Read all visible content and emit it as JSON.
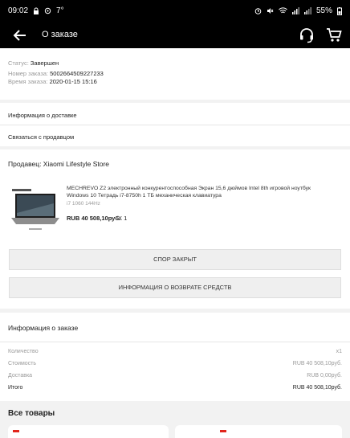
{
  "status_bar": {
    "time": "09:02",
    "temperature": "7°",
    "battery": "55%"
  },
  "app_bar": {
    "title": "О заказе"
  },
  "order": {
    "status_label": "Статус:",
    "status_value": "Завершен",
    "number_label": "Номер заказа:",
    "number_value": "5002664509227233",
    "time_label": "Время заказа:",
    "time_value": "2020-01-15 15:16"
  },
  "links": {
    "delivery_info": "Информация о доставке",
    "contact_seller": "Связаться с продавцом"
  },
  "seller": {
    "label": "Продавец: Xiaomi Lifestyle Store"
  },
  "product": {
    "title": "MECHREVO Z2 электронный конкурентоспособная Экран 15,6 дюймов Intel 8th игровой ноутбук Windows 10 Тетрадь i7-8750h 1 ТБ механическая клавиатура",
    "spec": "i7 1060 144Hz",
    "price": "RUB 40 508,10руб.",
    "qty": "X 1"
  },
  "buttons": {
    "dispute": "СПОР ЗАКРЫТ",
    "refund_info": "ИНФОРМАЦИЯ О ВОЗВРАТЕ СРЕДСТВ"
  },
  "summary": {
    "title": "Информация о заказе",
    "rows": [
      {
        "label": "Количество",
        "value": "x1"
      },
      {
        "label": "Стоимость",
        "value": "RUB 40 508,10руб."
      },
      {
        "label": "Доставка",
        "value": "RUB 0,00руб."
      },
      {
        "label": "Итого",
        "value": "RUB 40 508,10руб."
      }
    ]
  },
  "all_products": {
    "title": "Все товары"
  },
  "colors": {
    "bar_bg": "#000000",
    "page_bg": "#f2f2f2",
    "card_bg": "#ffffff",
    "muted_text": "#9a9a9a",
    "accent_red": "#e1251b"
  },
  "icons": [
    "back-arrow-icon",
    "headset-icon",
    "cart-icon",
    "wifi-icon",
    "signal-icon",
    "battery-icon"
  ]
}
